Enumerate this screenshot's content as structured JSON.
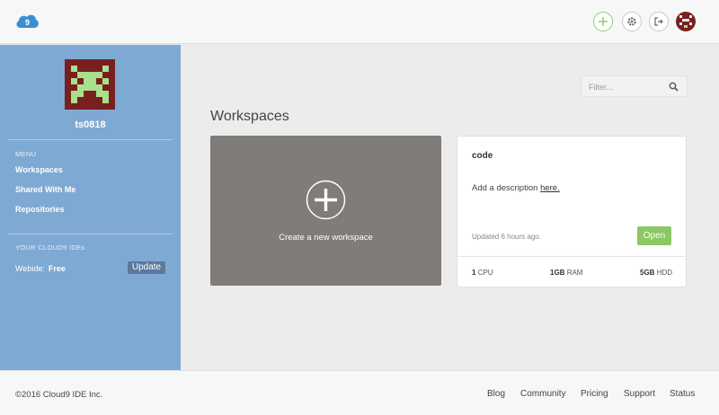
{
  "header": {
    "logo_text": "9"
  },
  "sidebar": {
    "username": "ts0818",
    "menu_label": "MENU",
    "menu_items": [
      {
        "label": "Workspaces"
      },
      {
        "label": "Shared With Me"
      },
      {
        "label": "Repositories"
      }
    ],
    "ides_label": "YOUR CLOUD9 IDEs",
    "webide_label": "Webide:",
    "webide_plan": "Free",
    "update_label": "Update"
  },
  "main": {
    "filter_placeholder": "Filter...",
    "title": "Workspaces",
    "create_label": "Create a new workspace",
    "workspace": {
      "name": "code",
      "desc_prefix": "Add a description",
      "desc_link": "here.",
      "updated": "Updated 6 hours ago.",
      "open_label": "Open",
      "cpu_value": "1",
      "cpu_unit": "CPU",
      "ram_value": "1GB",
      "ram_unit": "RAM",
      "hdd_value": "5GB",
      "hdd_unit": "HDD"
    }
  },
  "footer": {
    "copyright": "©2016  Cloud9 IDE Inc.",
    "links": [
      "Blog",
      "Community",
      "Pricing",
      "Support",
      "Status"
    ]
  },
  "colors": {
    "sidebar": "#7ea9d3",
    "accent_green": "#8bc763",
    "create_card": "#7f7c79",
    "avatar_red": "#7a1f1f",
    "avatar_green": "#a8e08c"
  }
}
